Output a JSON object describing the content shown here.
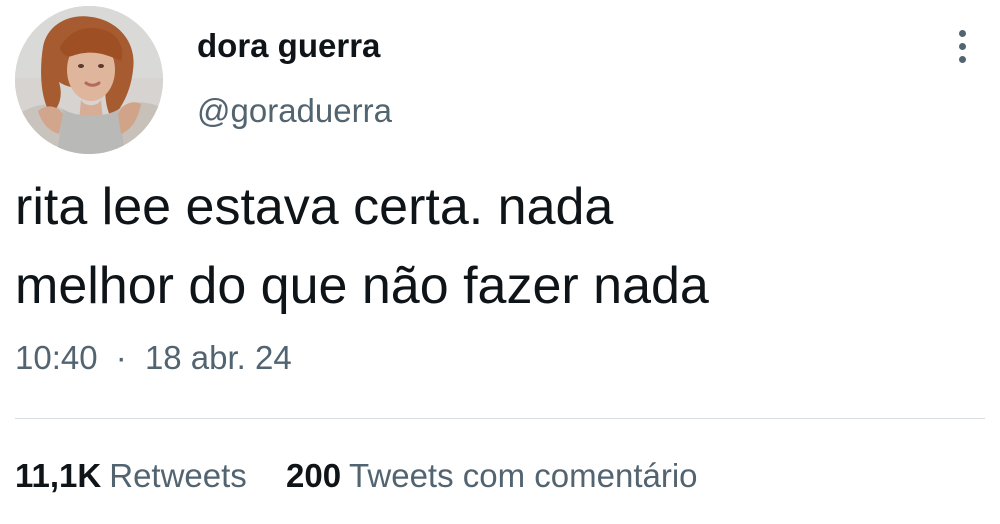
{
  "author": {
    "display_name": "dora guerra",
    "handle": "@goraduerra",
    "avatar_icon": "profile-photo"
  },
  "tweet": {
    "text_lines": [
      "rita lee estava certa. nada",
      "melhor do que não fazer nada"
    ],
    "time": "10:40",
    "separator": "·",
    "date": "18 abr. 24"
  },
  "stats": {
    "retweets_count": "11,1K",
    "retweets_label": "Retweets",
    "quotes_count": "200",
    "quotes_label": "Tweets com comentário"
  },
  "icons": {
    "more": "more-vertical-icon"
  },
  "colors": {
    "primary_text": "#0f1419",
    "secondary_text": "#536471",
    "divider": "#d9dee2"
  }
}
